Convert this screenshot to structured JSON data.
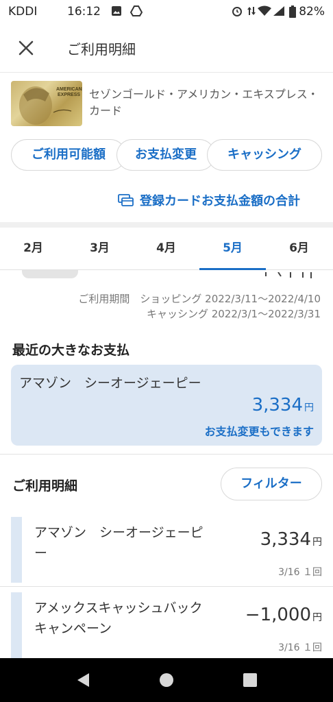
{
  "status_bar": {
    "carrier": "KDDI",
    "time": "16:12",
    "battery": "82%"
  },
  "header": {
    "title": "ご利用明細"
  },
  "card": {
    "name": "セゾンゴールド・アメリカン・エキスプレス・カード",
    "brand_text_1": "AMERICAN",
    "brand_text_2": "EXPRESS"
  },
  "actions": {
    "available": "ご利用可能額",
    "change": "お支払変更",
    "cashing": "キャッシング"
  },
  "total_link": "登録カードお支払金額の合計",
  "tabs": [
    {
      "label": "2月"
    },
    {
      "label": "3月"
    },
    {
      "label": "4月"
    },
    {
      "label": "5月",
      "active": true
    },
    {
      "label": "6月"
    }
  ],
  "period": {
    "shopping": "ご利用期間　ショッピング 2022/3/11〜2022/4/10",
    "cashing": "キャッシング 2022/3/1〜2022/3/31"
  },
  "recent": {
    "title": "最近の大きなお支払",
    "merchant": "アマゾン　シーオージェーピー",
    "amount": "3,334",
    "yen": "円",
    "change_link": "お支払変更もできます"
  },
  "details": {
    "title": "ご利用明細",
    "filter": "フィルター",
    "items": [
      {
        "merchant": "アマゾン　シーオージェーピー",
        "amount": "3,334",
        "yen": "円",
        "meta": "3/16 １回"
      },
      {
        "merchant": "アメックスキャッシュバックキャンペーン",
        "amount": "−1,000",
        "yen": "円",
        "meta": "3/16 １回"
      }
    ]
  },
  "colors": {
    "accent": "#1a6ec6",
    "highlight_bg": "#dce7f4"
  }
}
